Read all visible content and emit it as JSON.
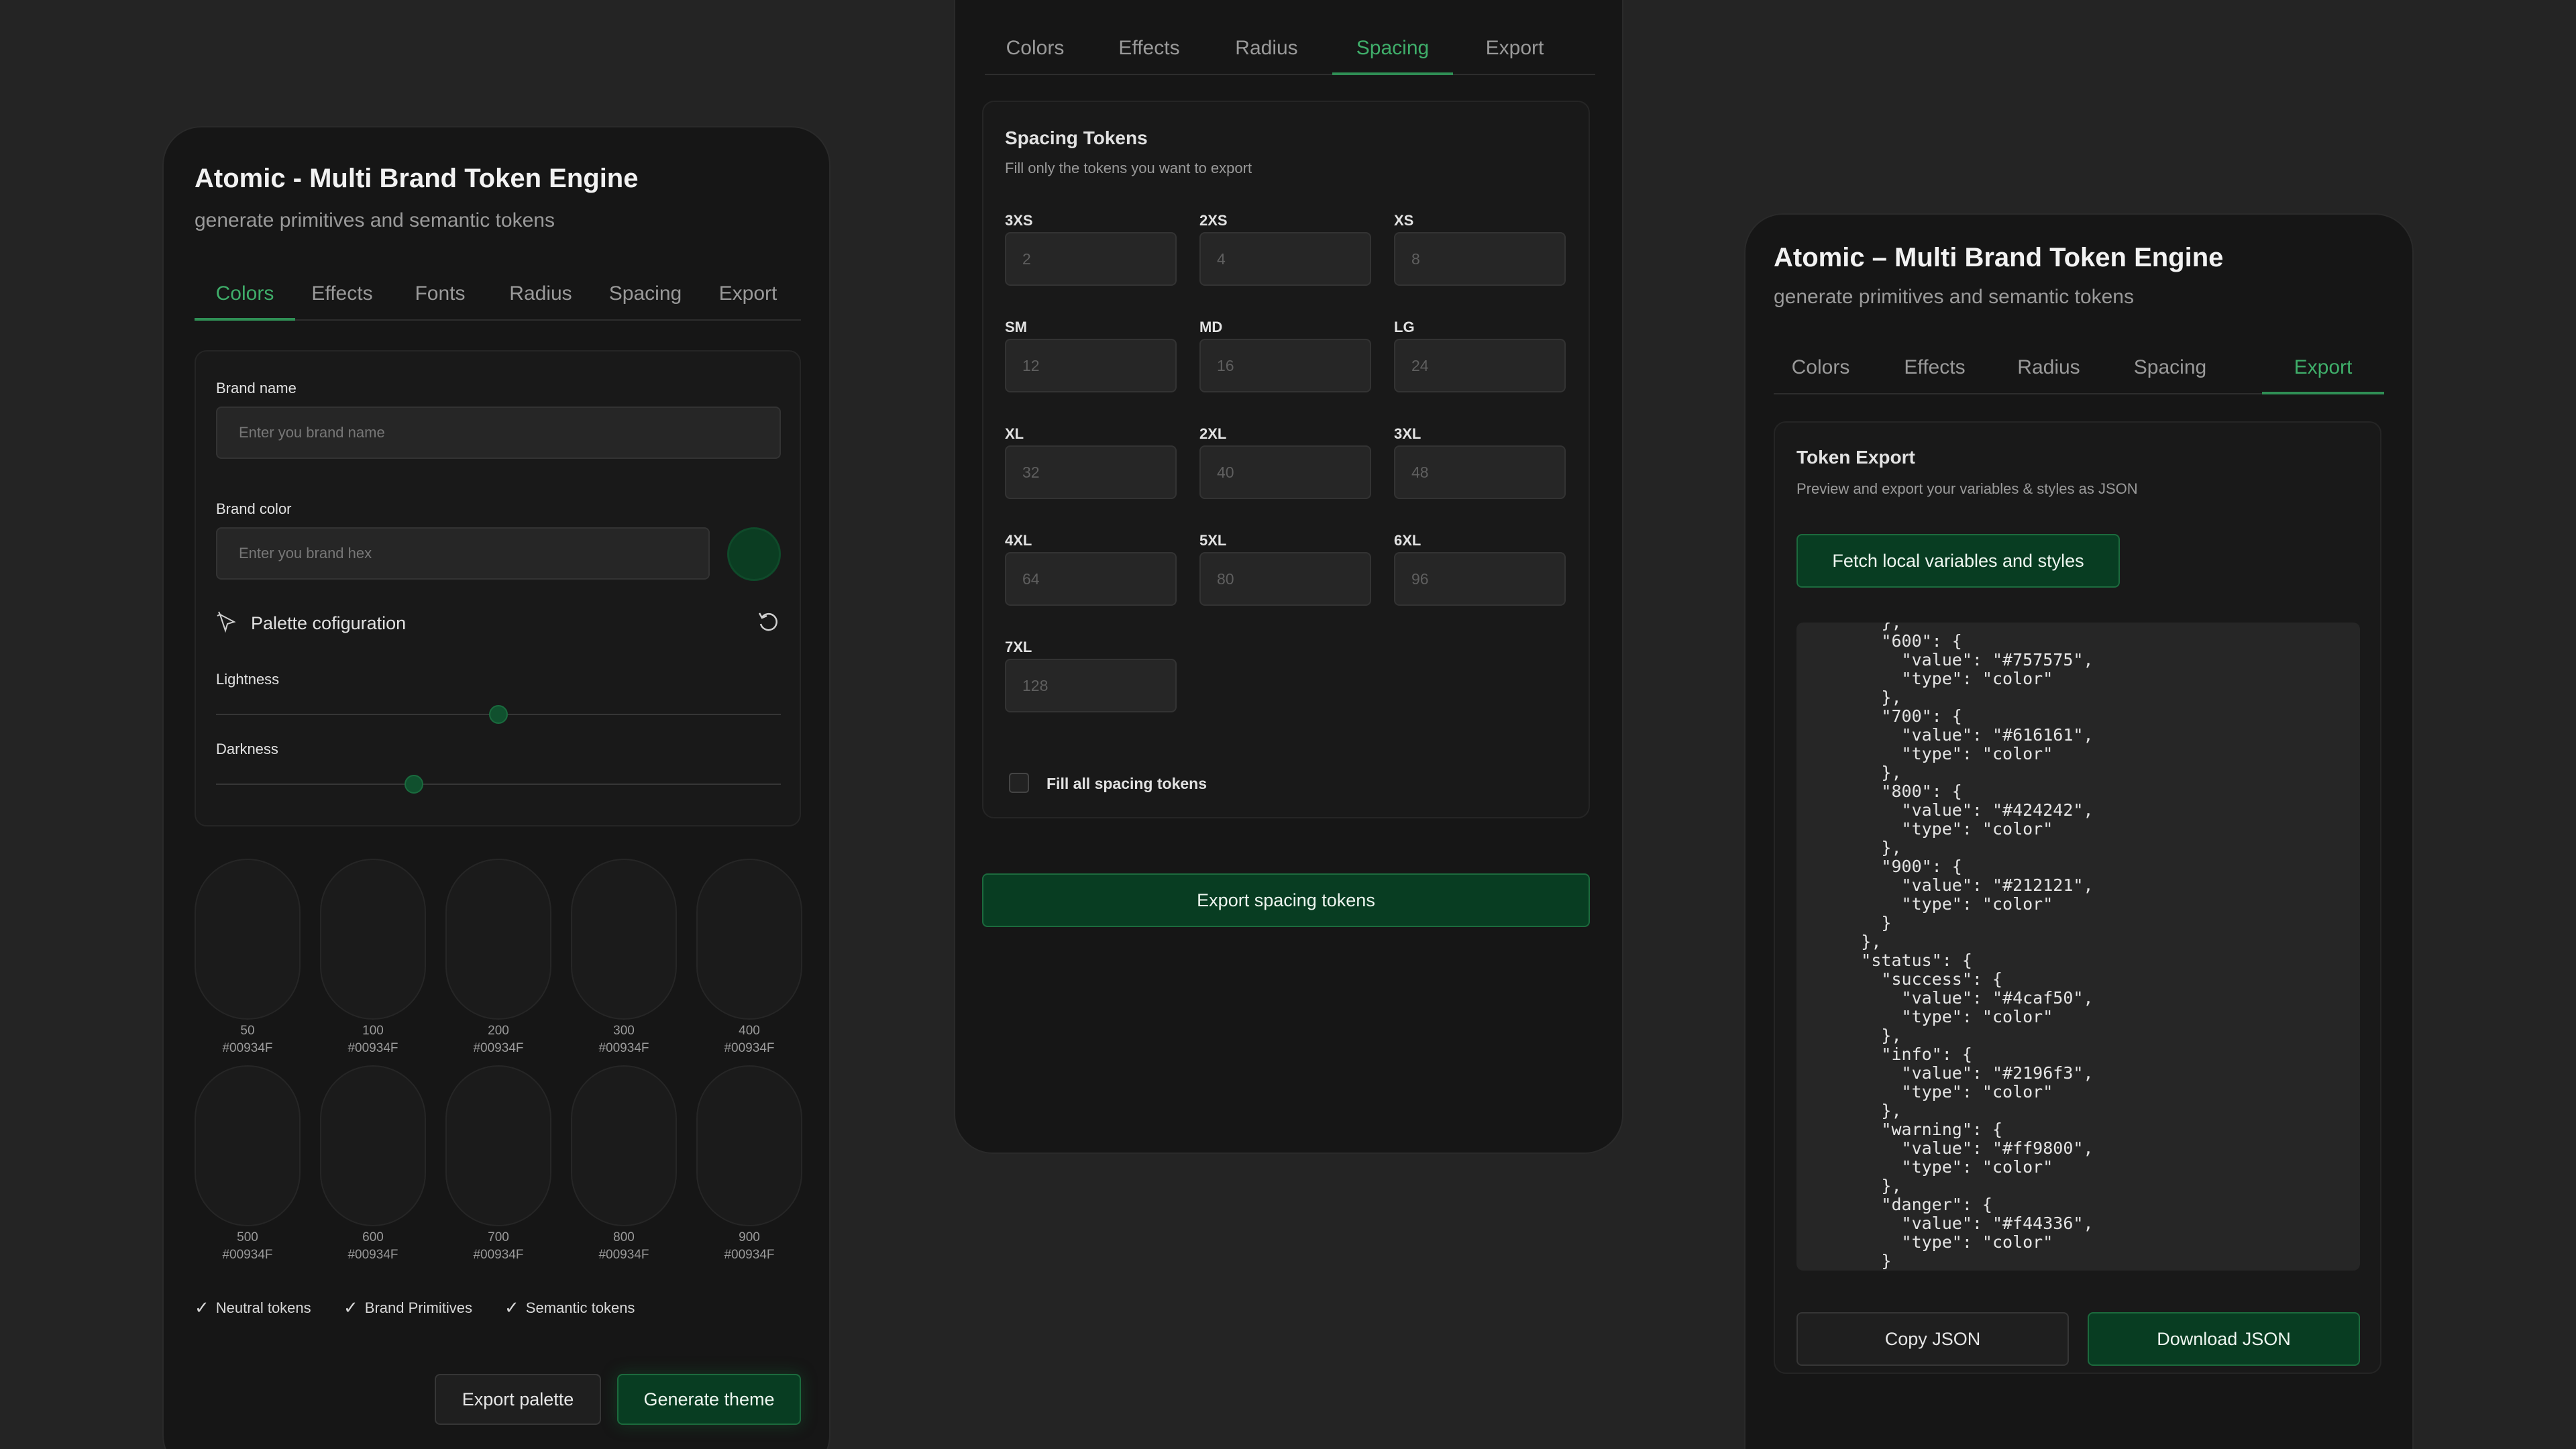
{
  "left": {
    "title": "Atomic - Multi Brand Token Engine",
    "subtitle": "generate primitives and semantic tokens",
    "tabs": [
      "Colors",
      "Effects",
      "Fonts",
      "Radius",
      "Spacing",
      "Export"
    ],
    "active_tab": "Colors",
    "brand_name_label": "Brand name",
    "brand_name_placeholder": "Enter you brand name",
    "brand_color_label": "Brand color",
    "brand_color_placeholder": "Enter you brand hex",
    "brand_color_swatch": "#0b3d22",
    "palette_title": "Palette cofiguration",
    "lightness_label": "Lightness",
    "lightness_value": 0.5,
    "darkness_label": "Darkness",
    "darkness_value": 0.35,
    "swatches": [
      {
        "step": "50",
        "hex": "#00934F"
      },
      {
        "step": "100",
        "hex": "#00934F"
      },
      {
        "step": "200",
        "hex": "#00934F"
      },
      {
        "step": "300",
        "hex": "#00934F"
      },
      {
        "step": "400",
        "hex": "#00934F"
      },
      {
        "step": "500",
        "hex": "#00934F"
      },
      {
        "step": "600",
        "hex": "#00934F"
      },
      {
        "step": "700",
        "hex": "#00934F"
      },
      {
        "step": "800",
        "hex": "#00934F"
      },
      {
        "step": "900",
        "hex": "#00934F"
      }
    ],
    "checks": [
      "Neutral tokens",
      "Brand Primitives",
      "Semantic tokens"
    ],
    "export_palette": "Export palette",
    "generate_theme": "Generate theme"
  },
  "mid": {
    "tabs": [
      "Colors",
      "Effects",
      "Radius",
      "Spacing",
      "Export"
    ],
    "active_tab": "Spacing",
    "panel_title": "Spacing Tokens",
    "panel_subtitle": "Fill only the tokens you want to export",
    "tokens": [
      {
        "label": "3XS",
        "placeholder": "2"
      },
      {
        "label": "2XS",
        "placeholder": "4"
      },
      {
        "label": "XS",
        "placeholder": "8"
      },
      {
        "label": "SM",
        "placeholder": "12"
      },
      {
        "label": "MD",
        "placeholder": "16"
      },
      {
        "label": "LG",
        "placeholder": "24"
      },
      {
        "label": "XL",
        "placeholder": "32"
      },
      {
        "label": "2XL",
        "placeholder": "40"
      },
      {
        "label": "3XL",
        "placeholder": "48"
      },
      {
        "label": "4XL",
        "placeholder": "64"
      },
      {
        "label": "5XL",
        "placeholder": "80"
      },
      {
        "label": "6XL",
        "placeholder": "96"
      },
      {
        "label": "7XL",
        "placeholder": "128"
      }
    ],
    "fill_all_label": "Fill all spacing tokens",
    "export_button": "Export spacing tokens"
  },
  "right": {
    "title": "Atomic – Multi Brand Token Engine",
    "subtitle": "generate primitives and semantic tokens",
    "tabs": [
      "Colors",
      "Effects",
      "Radius",
      "Spacing",
      "Export"
    ],
    "active_tab": "Export",
    "panel_title": "Token Export",
    "panel_subtitle": "Preview and export your variables & styles as JSON",
    "fetch_button": "Fetch local variables and styles",
    "code_lines": [
      "        },",
      "        \"600\": {",
      "          \"value\": \"#757575\",",
      "          \"type\": \"color\"",
      "        },",
      "        \"700\": {",
      "          \"value\": \"#616161\",",
      "          \"type\": \"color\"",
      "        },",
      "        \"800\": {",
      "          \"value\": \"#424242\",",
      "          \"type\": \"color\"",
      "        },",
      "        \"900\": {",
      "          \"value\": \"#212121\",",
      "          \"type\": \"color\"",
      "        }",
      "      },",
      "      \"status\": {",
      "        \"success\": {",
      "          \"value\": \"#4caf50\",",
      "          \"type\": \"color\"",
      "        },",
      "        \"info\": {",
      "          \"value\": \"#2196f3\",",
      "          \"type\": \"color\"",
      "        },",
      "        \"warning\": {",
      "          \"value\": \"#ff9800\",",
      "          \"type\": \"color\"",
      "        },",
      "        \"danger\": {",
      "          \"value\": \"#f44336\",",
      "          \"type\": \"color\"",
      "        }"
    ],
    "copy_button": "Copy JSON",
    "download_button": "Download JSON"
  },
  "colors": {
    "accent": "#3fae6a",
    "button_green": "#083d22"
  }
}
